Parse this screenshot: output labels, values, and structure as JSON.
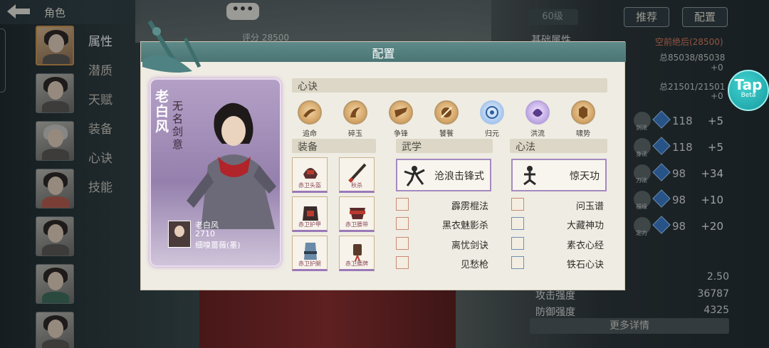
{
  "header": {
    "title": "角色",
    "bubble": "•••"
  },
  "sidebar": {
    "menu": [
      "属性",
      "潜质",
      "天赋",
      "装备",
      "心诀",
      "技能"
    ]
  },
  "right_panel": {
    "level": "60级",
    "recommend_label": "推荐",
    "config_label": "配置",
    "base_attr_label": "基础属性",
    "status_red": "空前绝后(28500)",
    "total_1": "总85038/85038",
    "total_1_add": "+0",
    "total_2": "总21501/21501",
    "total_2_add": "+0",
    "stats": [
      {
        "label": "剑法",
        "value": "118",
        "add": "+5"
      },
      {
        "label": "身法",
        "value": "118",
        "add": "+5"
      },
      {
        "label": "刀法",
        "value": "98",
        "add": "+34"
      },
      {
        "label": "福缘",
        "value": "98",
        "add": "+10"
      },
      {
        "label": "定力",
        "value": "98",
        "add": "+20"
      }
    ],
    "bottom_stats": [
      {
        "label": "",
        "value": "2.50"
      },
      {
        "label": "攻击强度",
        "value": "36787"
      },
      {
        "label": "防御强度",
        "value": "4325"
      }
    ],
    "more_label": "更多详情",
    "score": "评分 28500"
  },
  "tap_badge": {
    "title": "Tap",
    "sub": "Beta"
  },
  "dialog": {
    "title": "配置",
    "hero": {
      "name": "老白风",
      "epithet": "无名剑意",
      "info_name": "老白风",
      "info_power": "2710",
      "info_weapon": "细嗅蔷薇(墨)"
    },
    "xinjue": {
      "label": "心诀",
      "items": [
        "追命",
        "碎玉",
        "争锋",
        "饕餮",
        "归元",
        "洪流",
        "啸势"
      ]
    },
    "equip": {
      "label": "装备",
      "items": [
        "赤卫头盔",
        "秋杀",
        "赤卫护甲",
        "赤卫腰带",
        "赤卫护腿",
        "赤卫腰牌"
      ]
    },
    "wuxue": {
      "label": "武学",
      "main": "沧浪击锋式",
      "subs": [
        "霹雳棍法",
        "黑衣魅影杀",
        "离忧剑诀",
        "见愁枪"
      ]
    },
    "xinfa": {
      "label": "心法",
      "main": "惊天功",
      "subs": [
        "问玉谱",
        "大藏神功",
        "素衣心经",
        "铁石心诀"
      ]
    }
  }
}
